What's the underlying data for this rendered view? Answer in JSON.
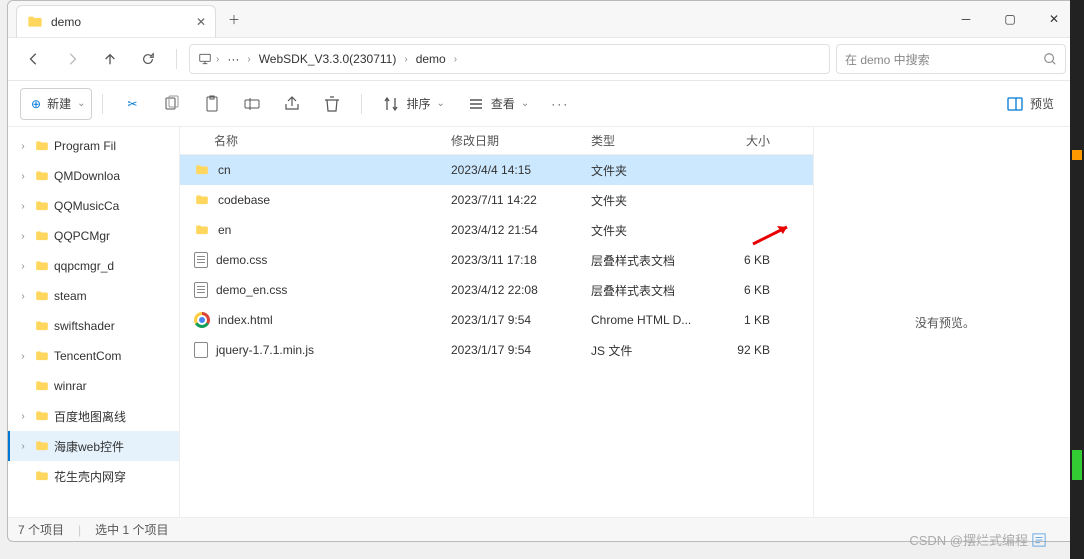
{
  "tab": {
    "title": "demo"
  },
  "breadcrumb": {
    "more": "···",
    "seg1": "WebSDK_V3.3.0(230711)",
    "seg2": "demo"
  },
  "search": {
    "placeholder": "在 demo 中搜索"
  },
  "toolbar": {
    "new_label": "新建",
    "sort_label": "排序",
    "view_label": "查看",
    "preview_label": "预览"
  },
  "tree": [
    {
      "label": "Program Fil",
      "exp": true
    },
    {
      "label": "QMDownloa",
      "exp": true
    },
    {
      "label": "QQMusicCa",
      "exp": true
    },
    {
      "label": "QQPCMgr",
      "exp": true
    },
    {
      "label": "qqpcmgr_d",
      "exp": true
    },
    {
      "label": "steam",
      "exp": true
    },
    {
      "label": "swiftshader",
      "exp": false
    },
    {
      "label": "TencentCom",
      "exp": true
    },
    {
      "label": "winrar",
      "exp": false
    },
    {
      "label": "百度地图离线",
      "exp": true
    },
    {
      "label": "海康web控件",
      "exp": true,
      "selected": true
    },
    {
      "label": "花生壳内网穿",
      "exp": false
    }
  ],
  "columns": {
    "name": "名称",
    "date": "修改日期",
    "type": "类型",
    "size": "大小"
  },
  "files": [
    {
      "name": "cn",
      "date": "2023/4/4 14:15",
      "type": "文件夹",
      "size": "",
      "icon": "folder",
      "selected": true
    },
    {
      "name": "codebase",
      "date": "2023/7/11 14:22",
      "type": "文件夹",
      "size": "",
      "icon": "folder"
    },
    {
      "name": "en",
      "date": "2023/4/12 21:54",
      "type": "文件夹",
      "size": "",
      "icon": "folder"
    },
    {
      "name": "demo.css",
      "date": "2023/3/11 17:18",
      "type": "层叠样式表文档",
      "size": "6 KB",
      "icon": "css"
    },
    {
      "name": "demo_en.css",
      "date": "2023/4/12 22:08",
      "type": "层叠样式表文档",
      "size": "6 KB",
      "icon": "css"
    },
    {
      "name": "index.html",
      "date": "2023/1/17 9:54",
      "type": "Chrome HTML D...",
      "size": "1 KB",
      "icon": "chrome"
    },
    {
      "name": "jquery-1.7.1.min.js",
      "date": "2023/1/17 9:54",
      "type": "JS 文件",
      "size": "92 KB",
      "icon": "js"
    }
  ],
  "preview": {
    "empty": "没有预览。"
  },
  "status": {
    "count": "7 个项目",
    "selected": "选中 1 个项目"
  },
  "watermark": "CSDN @摆烂式编程"
}
